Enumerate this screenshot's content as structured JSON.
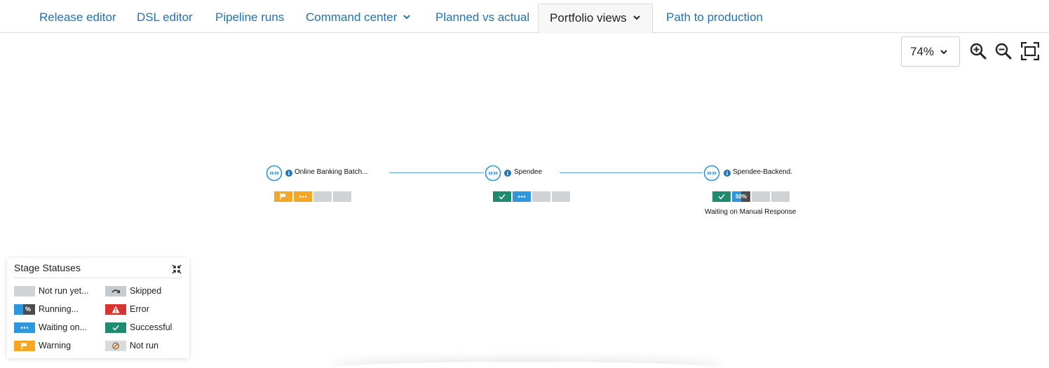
{
  "tabs": [
    {
      "label": "Release editor"
    },
    {
      "label": "DSL editor"
    },
    {
      "label": "Pipeline runs"
    },
    {
      "label": "Command center"
    },
    {
      "label": "Planned vs actual"
    },
    {
      "label": "Portfolio views"
    },
    {
      "label": "Path to production"
    }
  ],
  "toolbar": {
    "zoom_value": "74%",
    "zoom_in_icon": "zoom-in-icon",
    "zoom_out_icon": "zoom-out-icon",
    "fit_icon": "fit-to-screen-icon"
  },
  "pipeline": {
    "nodes": [
      {
        "title": "Online Banking Batch...",
        "stages": [
          "warning",
          "waiting",
          "not-run-yet",
          "not-run-yet"
        ],
        "status": ""
      },
      {
        "title": "Spendee",
        "stages": [
          "successful",
          "waiting",
          "not-run-yet",
          "not-run-yet"
        ],
        "status": ""
      },
      {
        "title": "Spendee-Backend.",
        "stages": [
          "successful",
          "running",
          "not-run-yet",
          "not-run-yet"
        ],
        "running_percent": "50%",
        "running_fraction": 0.5,
        "status": "Waiting on Manual Response"
      }
    ]
  },
  "legend": {
    "title": "Stage Statuses",
    "items": [
      {
        "label": "Not run yet..."
      },
      {
        "label": "Running...",
        "swatch_text": "%"
      },
      {
        "label": "Waiting on..."
      },
      {
        "label": "Warning"
      },
      {
        "label": "Skipped"
      },
      {
        "label": "Error"
      },
      {
        "label": "Successful"
      },
      {
        "label": "Not run"
      }
    ]
  },
  "colors": {
    "link": "#1f73b7",
    "connector": "#5aa6dc",
    "warning": "#f5a623",
    "waiting": "#2d96dc",
    "successful": "#1e8a6e",
    "error": "#d8332f",
    "not_run_yet": "#cfd3d6",
    "running": "#4c4c4c"
  }
}
